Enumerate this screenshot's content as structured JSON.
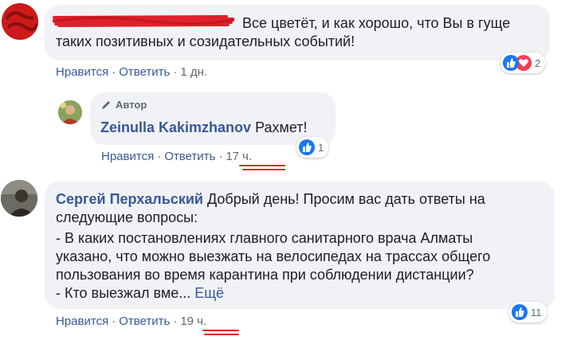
{
  "comments": [
    {
      "text_line1": "Все цветёт, и как хорошо, что Вы в гуще",
      "text_line2": "таких позитивных и созидательных событий!",
      "actions": {
        "like": "Нравится",
        "reply": "Ответить",
        "time": "1 дн."
      },
      "reactions": {
        "count": "2",
        "icons": [
          "like-icon",
          "love-icon"
        ]
      },
      "colors": {
        "redaction": "#e0202a"
      }
    },
    {
      "badge": "Автор",
      "author": "Zeinulla Kakimzhanov",
      "text": "Рахмет!",
      "actions": {
        "like": "Нравится",
        "reply": "Ответить",
        "time": "17 ч."
      },
      "reactions": {
        "count": "1",
        "icons": [
          "like-icon"
        ]
      }
    },
    {
      "author": "Сергей Перхальский",
      "text_line1": "Добрый день! Просим вас дать ответы на",
      "text_line2": "следующие вопросы:",
      "text_line3": "- В каких постановлениях главного санитарного врача Алматы",
      "text_line4": "указано, что можно выезжать на велосипедах на трассах общего",
      "text_line5": "пользования во время карантина при соблюдении дистанции?",
      "text_line6": "- Кто выезжал вме...",
      "more": "Ещё",
      "actions": {
        "like": "Нравится",
        "reply": "Ответить",
        "time": "19 ч."
      },
      "reactions": {
        "count": "11",
        "icons": [
          "like-icon"
        ]
      }
    }
  ],
  "colors": {
    "link": "#385898",
    "bubble": "#f0f2f5",
    "like": "#1877f2",
    "love": "#f33e58",
    "annotation": "#e0202a"
  }
}
